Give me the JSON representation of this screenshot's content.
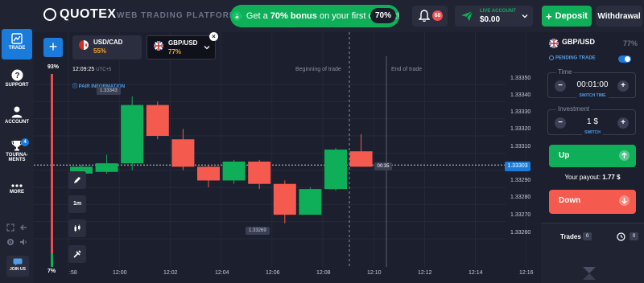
{
  "brand": {
    "logo_text": "QUOTEX",
    "platform_text": "WEB TRADING PLATFORM"
  },
  "promo": {
    "text_prefix": "Get a ",
    "text_bold": "70% bonus",
    "text_suffix": " on your first deposit!",
    "badge": "70%"
  },
  "notifications": {
    "count": "68"
  },
  "account": {
    "label": "LIVE ACCOUNT",
    "balance": "$0.00"
  },
  "header_buttons": {
    "deposit": "Deposit",
    "withdrawal": "Withdrawal"
  },
  "nav": {
    "items": [
      {
        "label": "TRADE",
        "icon": "chart-icon"
      },
      {
        "label": "SUPPORT",
        "icon": "question-icon"
      },
      {
        "label": "ACCOUNT",
        "icon": "user-icon"
      },
      {
        "label": "TOURNA-\nMENTS",
        "icon": "trophy-icon",
        "badge": "4"
      },
      {
        "label": "MORE",
        "icon": "dots-icon"
      }
    ],
    "join_us": "JOIN US"
  },
  "assets": [
    {
      "name": "USD/CAD",
      "payout": "55%"
    },
    {
      "name": "GBP/USD",
      "payout": "77%"
    }
  ],
  "chart_header": {
    "time": "12:09:25",
    "timezone": "UTC+5",
    "pair_info": "PAIR INFORMATION"
  },
  "sentiment": {
    "up_pct": "93%",
    "down_pct": "7%",
    "up_fraction": 0.93
  },
  "tools": {
    "timeframe": "1m"
  },
  "markers": {
    "beginning": "Beginning of trade",
    "end": "End of trade"
  },
  "chart_data": {
    "type": "candlestick",
    "x_ticks": [
      ":58",
      "12:00",
      "12:02",
      "12:04",
      "12:06",
      "12:08",
      "12:10",
      "12:12",
      "12:14",
      "12:16"
    ],
    "y_ticks": [
      "1.33350",
      "1.33340",
      "1.33330",
      "1.33320",
      "1.33310",
      "1.33300",
      "1.33290",
      "1.33280",
      "1.33270",
      "1.33260"
    ],
    "ylim": [
      1.33255,
      1.33355
    ],
    "current_price": "1.33303",
    "timer": "00:35",
    "high_label": "1.33343",
    "low_label": "1.33269",
    "candles": [
      {
        "o": 1.33298,
        "c": 1.33302,
        "h": 1.33303,
        "l": 1.33292
      },
      {
        "o": 1.33299,
        "c": 1.33304,
        "h": 1.33309,
        "l": 1.33298
      },
      {
        "o": 1.33304,
        "c": 1.33338,
        "h": 1.33343,
        "l": 1.333
      },
      {
        "o": 1.33338,
        "c": 1.3332,
        "h": 1.3334,
        "l": 1.33318
      },
      {
        "o": 1.33318,
        "c": 1.33302,
        "h": 1.33324,
        "l": 1.333
      },
      {
        "o": 1.33302,
        "c": 1.33294,
        "h": 1.33303,
        "l": 1.3329
      },
      {
        "o": 1.33294,
        "c": 1.33305,
        "h": 1.33306,
        "l": 1.33292
      },
      {
        "o": 1.33305,
        "c": 1.33292,
        "h": 1.33306,
        "l": 1.33289
      },
      {
        "o": 1.33292,
        "c": 1.33274,
        "h": 1.33294,
        "l": 1.33269
      },
      {
        "o": 1.33274,
        "c": 1.33289,
        "h": 1.3329,
        "l": 1.33274
      },
      {
        "o": 1.33289,
        "c": 1.33312,
        "h": 1.33313,
        "l": 1.33288
      },
      {
        "o": 1.33311,
        "c": 1.33302,
        "h": 1.33321,
        "l": 1.33302
      }
    ],
    "colors": {
      "up": "#0faf59",
      "down": "#f55a4e"
    }
  },
  "trade_panel": {
    "asset": "GBP/USD",
    "payout": "77%",
    "pending": "PENDING TRADE",
    "time_label": "Time",
    "time_value": "00:01:00",
    "switch_time": "SWITCH TIME",
    "investment_label": "Investment",
    "investment_value": "1 $",
    "switch": "SWITCH",
    "up": "Up",
    "payout_label": "Your payout: ",
    "payout_value": "1.77 $",
    "down": "Down",
    "trades_tab": "Trades",
    "trades_count": "0",
    "pending_count": "0"
  }
}
